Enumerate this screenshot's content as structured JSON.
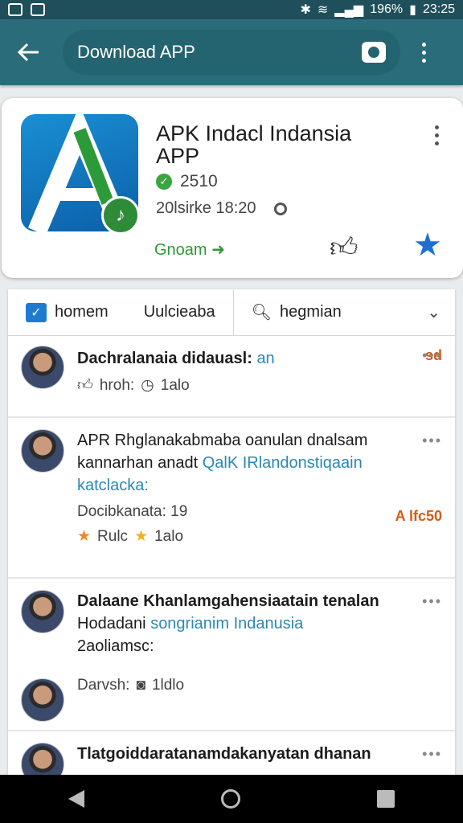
{
  "status": {
    "battery": "196%",
    "time": "23:25"
  },
  "appbar": {
    "search_text": "Download APP"
  },
  "app": {
    "title": "APK Indacl Indansia",
    "subtitle": "APP",
    "version": "2510",
    "date": "20lsirke 18:20",
    "download_label": "Gnoam",
    "logo_letter": "A"
  },
  "tabs": [
    {
      "label": "homem",
      "icon": "checkbox-icon"
    },
    {
      "label": "Uulcieaba"
    },
    {
      "label": "hegmian",
      "icon": "search-icon"
    }
  ],
  "posts": [
    {
      "title": "Dachralanaia didauasl:",
      "highlight": "an",
      "meta1": "hroh:",
      "meta2": "1alo",
      "tag": "sd"
    },
    {
      "title": "APR Rhglanakabmaba oanulan dnalsam",
      "line2": "kannarhan anadt",
      "highlight": "QalK IRlandonstiqaain",
      "line3": "katclacka:",
      "meta1": "Docibkanata: 19",
      "tag": "A lfc50",
      "meta2a": "Rulc",
      "meta2b": "1alo"
    },
    {
      "title": "Dalaane Khanlamgahensiaatain tenalan",
      "line2": "Hodadani",
      "highlight": "songrianim Indanusia",
      "line3": "2aoliamsc:"
    },
    {
      "title": "Darvsh:",
      "meta2": "1ldlo"
    },
    {
      "title": "Tlatgoiddaratanamdakanyatan dhanan"
    }
  ]
}
